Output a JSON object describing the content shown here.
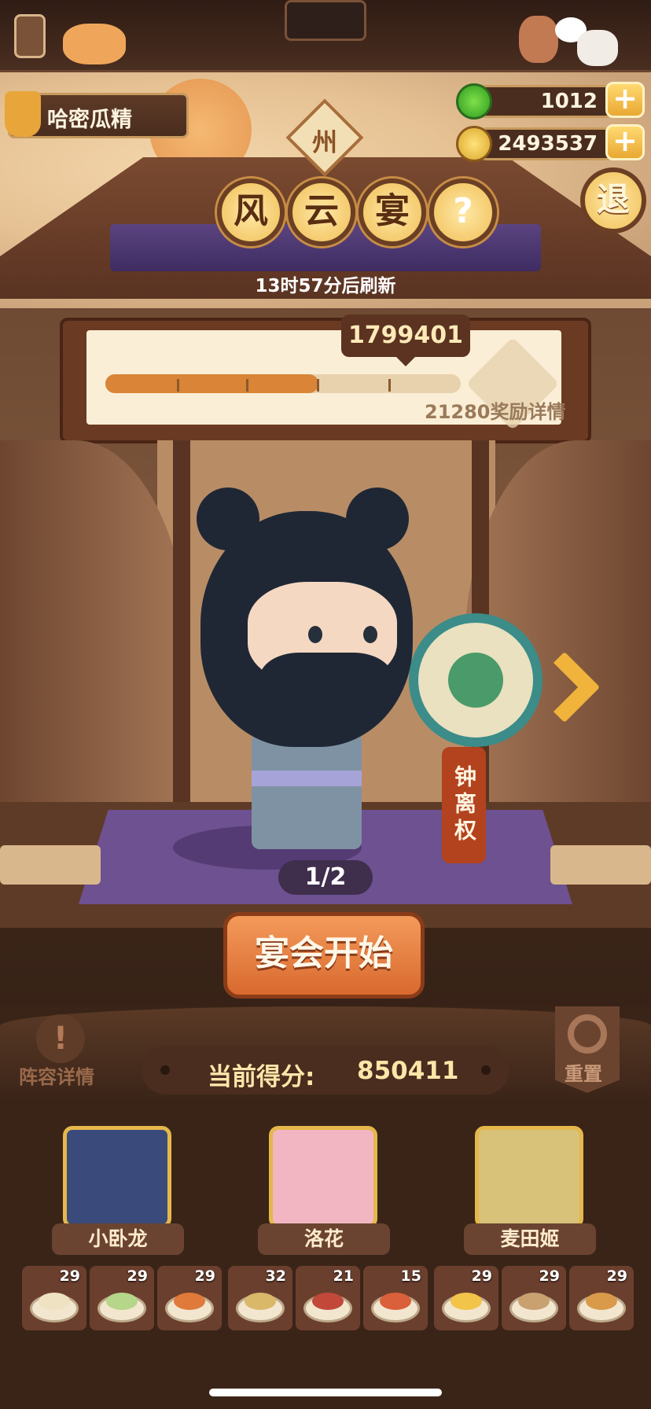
{
  "player": {
    "name": "哈密瓜精"
  },
  "currency": {
    "jade": "1012",
    "coins": "2493537",
    "plus": "+"
  },
  "region_badge": "州",
  "title": {
    "chars": [
      "风",
      "云",
      "宴"
    ],
    "help": "?"
  },
  "refresh_text": "13时57分后刷新",
  "exit_label": "退",
  "progress": {
    "score_bubble": "1799401",
    "fill_fraction": 0.6,
    "reward_threshold_text": "21280奖励详情"
  },
  "character": {
    "name": "钟离权",
    "page": "1/2"
  },
  "start_button": "宴会开始",
  "lineup_label": "阵容详情",
  "lineup_icon": "!",
  "score": {
    "label": "当前得分:",
    "value": "850411"
  },
  "reset_label": "重置",
  "heroes": [
    {
      "name": "小卧龙",
      "color": "#3a4a7a"
    },
    {
      "name": "洛花",
      "color": "#f2b6c2"
    },
    {
      "name": "麦田姬",
      "color": "#d8c27a"
    }
  ],
  "dishes": [
    {
      "count": "29",
      "color": "#efe2c2"
    },
    {
      "count": "29",
      "color": "#b6d68a"
    },
    {
      "count": "29",
      "color": "#e07a3a"
    },
    {
      "count": "32",
      "color": "#d9b86a"
    },
    {
      "count": "21",
      "color": "#c2483a"
    },
    {
      "count": "15",
      "color": "#d9603a"
    },
    {
      "count": "29",
      "color": "#f2c44a"
    },
    {
      "count": "29",
      "color": "#c9a070"
    },
    {
      "count": "29",
      "color": "#d99a4a"
    }
  ]
}
